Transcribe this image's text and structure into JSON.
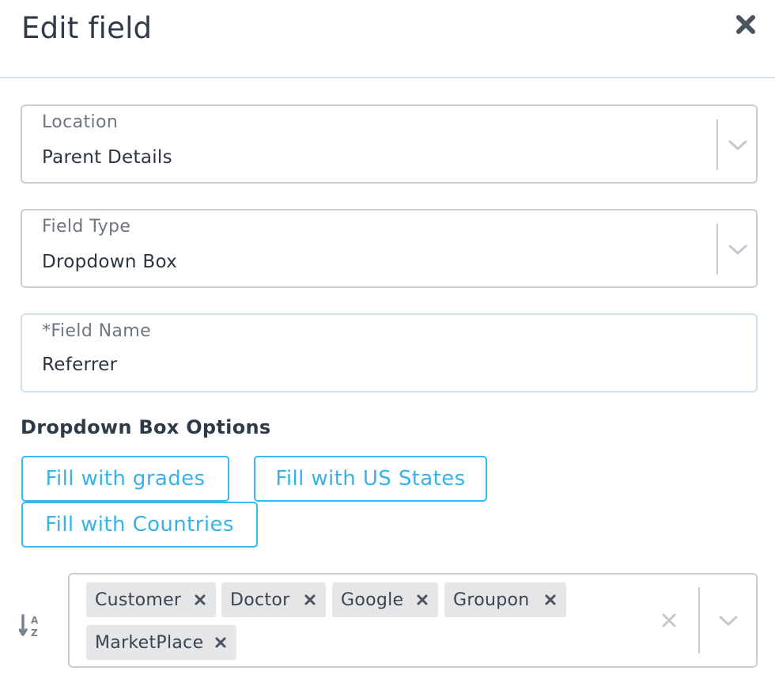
{
  "modal": {
    "title": "Edit field",
    "close_icon": "close-icon"
  },
  "location": {
    "label": "Location",
    "value": "Parent Details",
    "icon": "chevron-down-icon"
  },
  "field_type": {
    "label": "Field Type",
    "value": "Dropdown Box",
    "icon": "chevron-down-icon"
  },
  "field_name": {
    "label": "*Field Name",
    "value": "Referrer"
  },
  "options_section": {
    "title": "Dropdown Box Options",
    "buttons": {
      "grades": "Fill with grades",
      "us_states": "Fill with US States",
      "countries": "Fill with Countries"
    },
    "sort_icon": "sort-alpha-icon",
    "tags": [
      "Customer",
      "Doctor",
      "Google",
      "Groupon",
      "MarketPlace"
    ],
    "clear_icon": "clear-all-icon",
    "dropdown_icon": "chevron-down-icon"
  },
  "colors": {
    "accent": "#36b3ea",
    "border": "#c8ced4",
    "tag_bg": "#e4e6e8",
    "text": "#2b3440",
    "label": "#6e7680"
  }
}
